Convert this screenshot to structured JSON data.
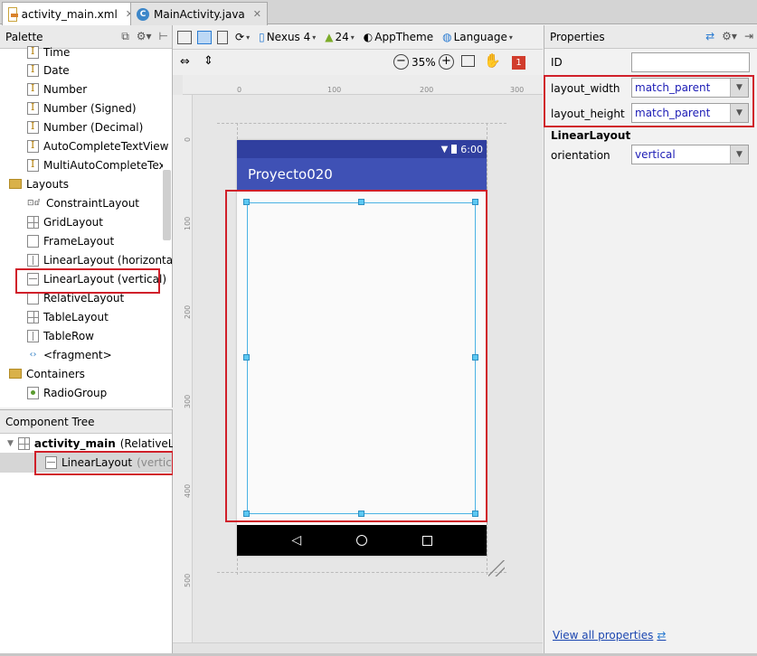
{
  "tabs": [
    {
      "label": "activity_main.xml",
      "icon": "xml-file-icon"
    },
    {
      "label": "MainActivity.java",
      "icon": "java-class-icon"
    }
  ],
  "palette": {
    "title": "Palette",
    "items": [
      {
        "label": "Time",
        "icon": "text-field-icon"
      },
      {
        "label": "Date",
        "icon": "text-field-icon"
      },
      {
        "label": "Number",
        "icon": "text-field-icon"
      },
      {
        "label": "Number (Signed)",
        "icon": "text-field-icon"
      },
      {
        "label": "Number (Decimal)",
        "icon": "text-field-icon"
      },
      {
        "label": "AutoCompleteTextView",
        "icon": "text-field-icon"
      },
      {
        "label": "MultiAutoCompleteTextView",
        "icon": "text-field-icon"
      },
      {
        "label": "Layouts",
        "icon": "folder-icon"
      },
      {
        "label": "ConstraintLayout",
        "icon": "constraint-layout-icon"
      },
      {
        "label": "GridLayout",
        "icon": "grid-layout-icon"
      },
      {
        "label": "FrameLayout",
        "icon": "frame-layout-icon"
      },
      {
        "label": "LinearLayout (horizontal)",
        "icon": "linear-horizontal-icon"
      },
      {
        "label": "LinearLayout (vertical)",
        "icon": "linear-vertical-icon"
      },
      {
        "label": "RelativeLayout",
        "icon": "relative-layout-icon"
      },
      {
        "label": "TableLayout",
        "icon": "table-layout-icon"
      },
      {
        "label": "TableRow",
        "icon": "table-row-icon"
      },
      {
        "label": "<fragment>",
        "icon": "fragment-icon"
      },
      {
        "label": "Containers",
        "icon": "folder-icon"
      },
      {
        "label": "RadioGroup",
        "icon": "radio-group-icon"
      }
    ]
  },
  "component_tree": {
    "title": "Component Tree",
    "root": {
      "name": "activity_main",
      "type": "(RelativeLayout)"
    },
    "child": {
      "name": "LinearLayout",
      "type": "(vertical)"
    }
  },
  "toolbar": {
    "device": "Nexus 4",
    "api": "24",
    "theme": "AppTheme",
    "language": "Language",
    "zoom": "35%",
    "warnings": "1"
  },
  "ruler": {
    "h": [
      "0",
      "100",
      "200",
      "300"
    ],
    "v": [
      "0",
      "100",
      "200",
      "300",
      "400",
      "500"
    ]
  },
  "device": {
    "status_time": "6:00",
    "app_title": "Proyecto020"
  },
  "properties": {
    "title": "Properties",
    "id_label": "ID",
    "id_value": "",
    "layout_width_label": "layout_width",
    "layout_width_value": "match_parent",
    "layout_height_label": "layout_height",
    "layout_height_value": "match_parent",
    "section": "LinearLayout",
    "orientation_label": "orientation",
    "orientation_value": "vertical",
    "view_all": "View all properties"
  },
  "colors": {
    "highlight": "#d0202a",
    "status_bar": "#303f9f",
    "app_bar": "#3f51b5",
    "selection": "#4ab2e4"
  }
}
